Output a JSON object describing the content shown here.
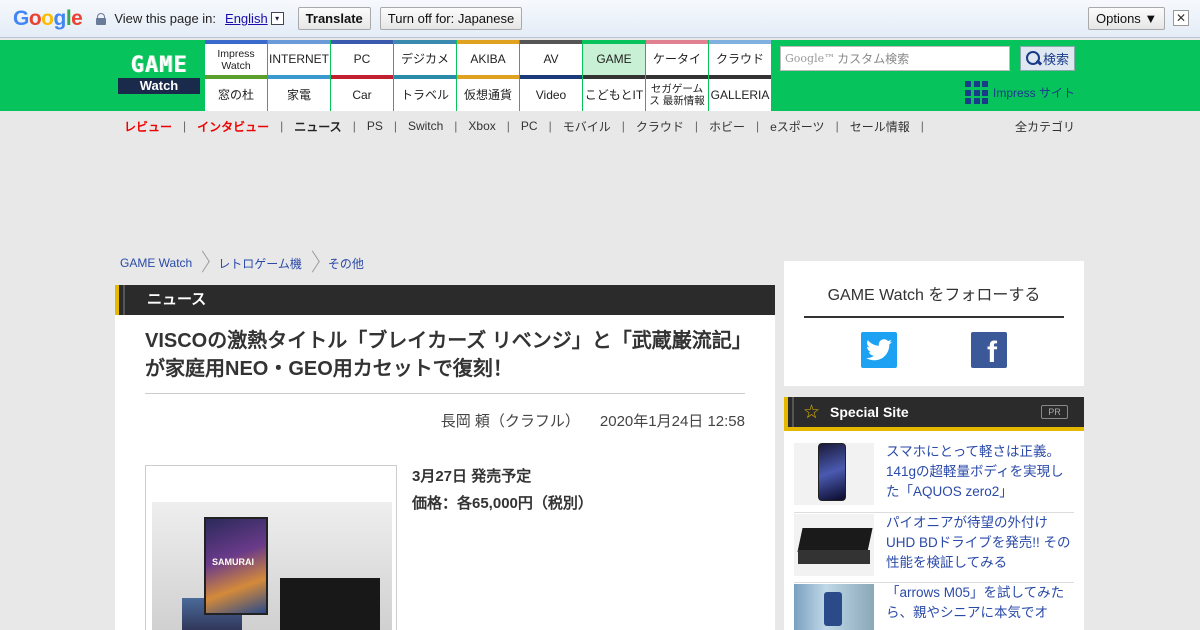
{
  "translate_bar": {
    "logo": "Google",
    "view_text": "View this page in:",
    "language": "English",
    "dropdown_glyph": "▾",
    "translate_label": "Translate",
    "turnoff_label": "Turn off for: Japanese",
    "options_label": "Options ▼",
    "close_glyph": "✕",
    "logo_colors": [
      "#4285f4",
      "#ea4335",
      "#fbbc05",
      "#4285f4",
      "#34a853",
      "#ea4335"
    ]
  },
  "header": {
    "logo_top": "GAME",
    "logo_bottom": "Watch",
    "nav_top": [
      {
        "label": "Impress Watch",
        "color": "#3a6acb"
      },
      {
        "label": "INTERNET",
        "color": "#6a9ad8"
      },
      {
        "label": "PC",
        "color": "#3a5ab0"
      },
      {
        "label": "デジカメ",
        "color": "#3a8ab0"
      },
      {
        "label": "AKIBA",
        "color": "#e0a020"
      },
      {
        "label": "AV",
        "color": "#555555"
      },
      {
        "label": "GAME",
        "color": "#07c35c"
      },
      {
        "label": "ケータイ",
        "color": "#e08090"
      },
      {
        "label": "クラウド",
        "color": "#80b0e0"
      }
    ],
    "nav_bottom": [
      {
        "label": "窓の杜",
        "color": "#5aa02a"
      },
      {
        "label": "家電",
        "color": "#3a9ad0"
      },
      {
        "label": "Car",
        "color": "#c02030"
      },
      {
        "label": "トラベル",
        "color": "#2a8aaa"
      },
      {
        "label": "仮想通貨",
        "color": "#e0a020"
      },
      {
        "label": "Video",
        "color": "#1a3a7a"
      },
      {
        "label": "こどもとIT",
        "color": "#333333"
      },
      {
        "label": "セガゲームス 最新情報",
        "color": "#333333"
      },
      {
        "label": "GALLERIA",
        "color": "#333333"
      }
    ],
    "search_placeholder_prefix": "Google™",
    "search_placeholder": "カスタム検索",
    "search_button": "検索",
    "impress_site": "Impress サイト"
  },
  "subnav": {
    "items": [
      {
        "label": "レビュー",
        "style": "red"
      },
      {
        "label": "インタビュー",
        "style": "red"
      },
      {
        "label": "ニュース",
        "style": "bold"
      },
      {
        "label": "PS",
        "style": ""
      },
      {
        "label": "Switch",
        "style": ""
      },
      {
        "label": "Xbox",
        "style": ""
      },
      {
        "label": "PC",
        "style": ""
      },
      {
        "label": "モバイル",
        "style": ""
      },
      {
        "label": "クラウド",
        "style": ""
      },
      {
        "label": "ホビー",
        "style": ""
      },
      {
        "label": "eスポーツ",
        "style": ""
      },
      {
        "label": "セール情報",
        "style": ""
      }
    ],
    "separator": "|",
    "all_categories": "全カテゴリ"
  },
  "breadcrumb": [
    "GAME Watch",
    "レトロゲーム機",
    "その他"
  ],
  "article": {
    "section": "ニュース",
    "title": "VISCOの激熱タイトル「ブレイカーズ リベンジ」と「武蔵巌流記」が家庭用NEO・GEO用カセットで復刻！",
    "author": "長岡 頼（クラフル）",
    "date": "2020年1月24日 12:58",
    "release_date": "3月27日 発売予定",
    "price": "価格：各65,000円（税別）"
  },
  "sidebar": {
    "follow_heading": "GAME Watch をフォローする",
    "twitter_glyph": "twitter-bird-icon",
    "facebook_glyph": "f",
    "special_title": "Special Site",
    "pr_badge": "PR",
    "special_items": [
      {
        "text": "スマホにとって軽さは正義。141gの超軽量ボディを実現した「AQUOS zero2」",
        "thumb": "phone"
      },
      {
        "text": "パイオニアが待望の外付けUHD BDドライブを発売!! その性能を検証してみる",
        "thumb": "drive"
      },
      {
        "text": "「arrows M05」を試してみたら、親やシニアに本気でオ",
        "thumb": "people"
      }
    ]
  }
}
